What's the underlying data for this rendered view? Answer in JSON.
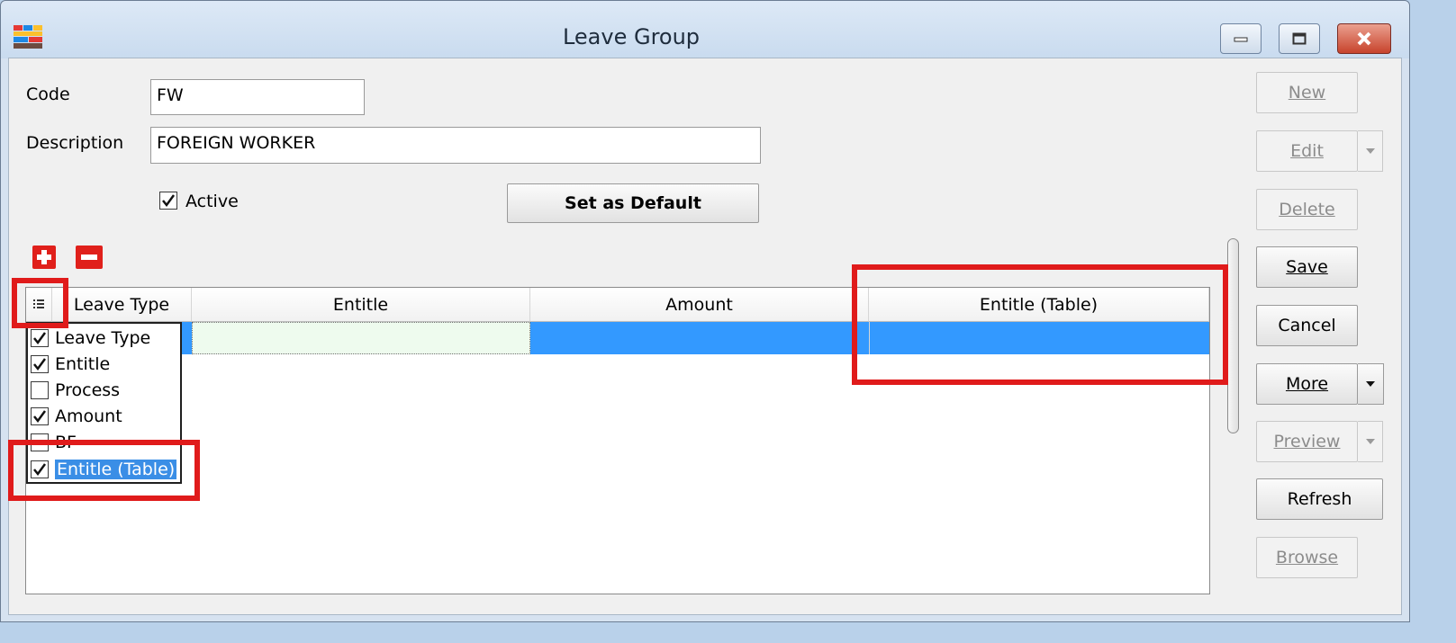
{
  "window": {
    "title": "Leave Group",
    "app_icon": "application-icon",
    "controls": [
      "minimize-icon",
      "maximize-icon",
      "close-icon"
    ]
  },
  "form": {
    "code_label": "Code",
    "code_value": "FW",
    "description_label": "Description",
    "description_value": "FOREIGN WORKER",
    "active_label": "Active",
    "active_checked": true,
    "set_default_label": "Set as Default"
  },
  "toolbar": {
    "add_icon": "plus-icon",
    "remove_icon": "minus-icon"
  },
  "grid": {
    "columns": [
      "Leave Type",
      "Entitle",
      "Amount",
      "Entitle (Table)"
    ],
    "column_chooser_icon": "column-list-icon"
  },
  "column_chooser": {
    "items": [
      {
        "label": "Leave Type",
        "checked": true
      },
      {
        "label": "Entitle",
        "checked": true
      },
      {
        "label": "Process",
        "checked": false
      },
      {
        "label": "Amount",
        "checked": true
      },
      {
        "label": "BF",
        "checked": false
      },
      {
        "label": "Entitle (Table)",
        "checked": true,
        "selected": true
      }
    ]
  },
  "side_buttons": {
    "new": "New",
    "edit": "Edit",
    "delete": "Delete",
    "save": "Save",
    "cancel": "Cancel",
    "more": "More",
    "preview": "Preview",
    "refresh": "Refresh",
    "browse": "Browse"
  },
  "colors": {
    "selection": "#3399ff",
    "highlight": "#e01b1b",
    "entitle_cell": "#eefbee"
  }
}
